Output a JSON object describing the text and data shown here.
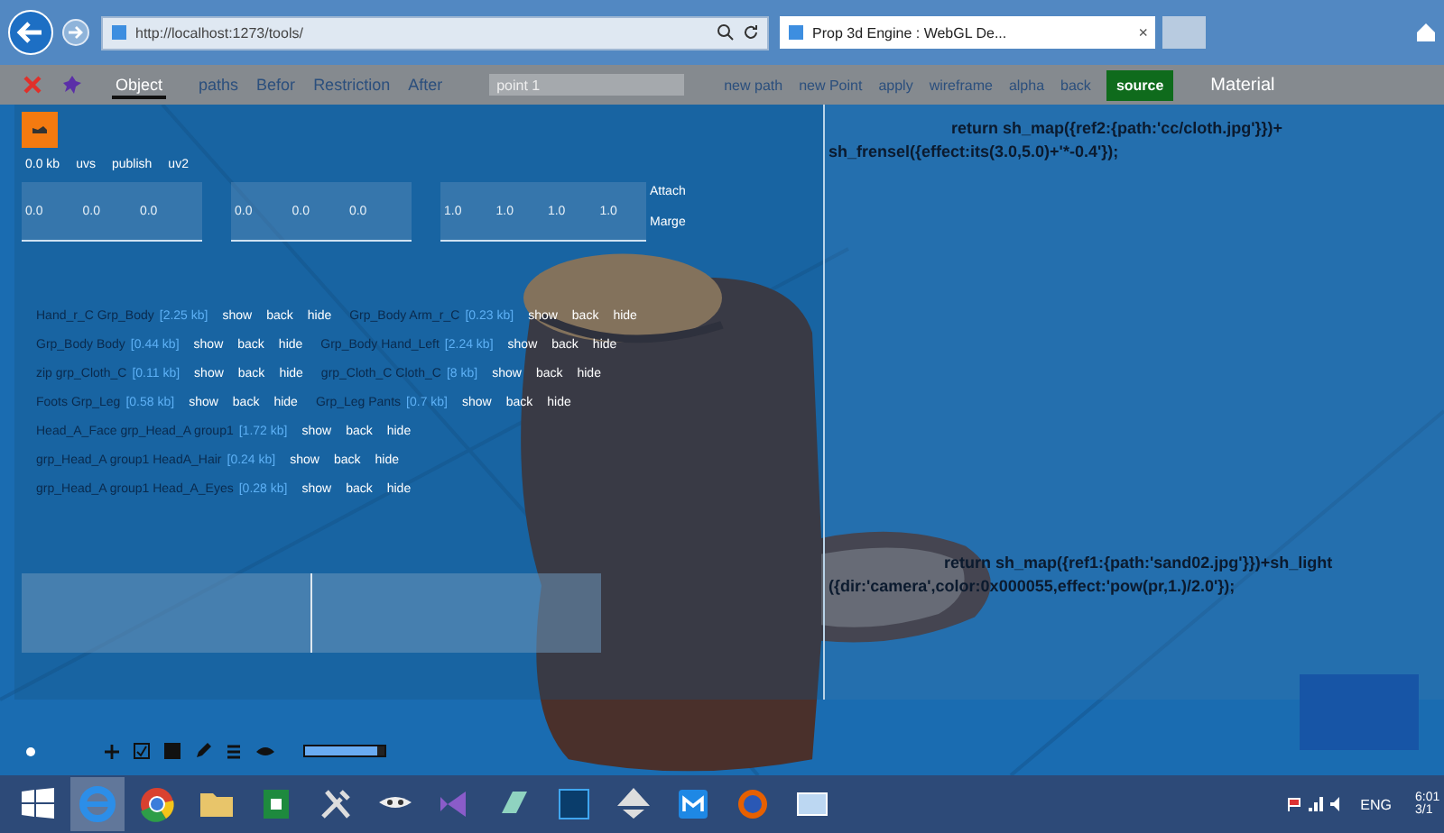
{
  "browser": {
    "url": "http://localhost:1273/tools/",
    "tab_title": "Prop 3d Engine : WebGL De...",
    "tab_close": "×"
  },
  "toolbar": {
    "tabs": [
      {
        "label": "Object",
        "selected": true
      },
      {
        "label": "paths",
        "selected": false
      },
      {
        "label": "Befor",
        "selected": false
      },
      {
        "label": "Restriction",
        "selected": false
      },
      {
        "label": "After",
        "selected": false
      }
    ],
    "point_field": {
      "value": "point 1"
    },
    "actions": [
      {
        "label": "new path",
        "kind": "link"
      },
      {
        "label": "new Point",
        "kind": "link"
      },
      {
        "label": "apply",
        "kind": "link"
      },
      {
        "label": "wireframe",
        "kind": "link"
      },
      {
        "label": "alpha",
        "kind": "link"
      },
      {
        "label": "back",
        "kind": "link"
      },
      {
        "label": "source",
        "kind": "primary"
      },
      {
        "label": "Material",
        "kind": "plain"
      }
    ]
  },
  "stats": [
    "0.0 kb",
    "uvs",
    "publish",
    "uv2"
  ],
  "vectors": [
    [
      "0.0",
      "0.0",
      "0.0"
    ],
    [
      "0.0",
      "0.0",
      "0.0"
    ],
    [
      "1.0",
      "1.0",
      "1.0",
      "1.0"
    ]
  ],
  "vector_actions": [
    "Attach",
    "Marge"
  ],
  "meshes": [
    [
      {
        "name": "Hand_r_C Grp_Body",
        "size": "[2.25 kb]",
        "actions": [
          "show",
          "back",
          "hide"
        ]
      },
      {
        "name": "Grp_Body Arm_r_C",
        "size": "[0.23 kb]",
        "actions": [
          "show",
          "back",
          "hide"
        ]
      }
    ],
    [
      {
        "name": "Grp_Body Body",
        "size": "[0.44 kb]",
        "actions": [
          "show",
          "back",
          "hide"
        ]
      },
      {
        "name": "Grp_Body Hand_Left",
        "size": "[2.24 kb]",
        "actions": [
          "show",
          "back",
          "hide"
        ]
      }
    ],
    [
      {
        "name": "zip grp_Cloth_C",
        "size": "[0.11 kb]",
        "actions": [
          "show",
          "back",
          "hide"
        ]
      },
      {
        "name": "grp_Cloth_C Cloth_C",
        "size": "[8 kb]",
        "actions": [
          "show",
          "back",
          "hide"
        ]
      }
    ],
    [
      {
        "name": "Foots Grp_Leg",
        "size": "[0.58 kb]",
        "actions": [
          "show",
          "back",
          "hide"
        ]
      },
      {
        "name": "Grp_Leg Pants",
        "size": "[0.7 kb]",
        "actions": [
          "show",
          "back",
          "hide"
        ]
      }
    ],
    [
      {
        "name": "Head_A_Face grp_Head_A group1",
        "size": "[1.72 kb]",
        "actions": [
          "show",
          "back",
          "hide"
        ]
      }
    ],
    [
      {
        "name": "grp_Head_A group1 HeadA_Hair",
        "size": "[0.24 kb]",
        "actions": [
          "show",
          "back",
          "hide"
        ]
      }
    ],
    [
      {
        "name": "grp_Head_A group1 Head_A_Eyes",
        "size": "[0.28 kb]",
        "actions": [
          "show",
          "back",
          "hide"
        ]
      }
    ]
  ],
  "code": [
    "return sh_map({ref2:{path:'cc/cloth.jpg'}})+ sh_frensel({effect:its(3.0,5.0)+'*-0.4'});",
    "return sh_map({ref1:{path:'sand02.jpg'}})+sh_light ({dir:'camera',color:0x000055,effect:'pow(pr,1.)/2.0'});"
  ],
  "bottom_tools": {
    "slider": {
      "level": 0.9
    }
  },
  "taskbar": {
    "language": "ENG",
    "time": "6:01",
    "date": "3/1"
  }
}
